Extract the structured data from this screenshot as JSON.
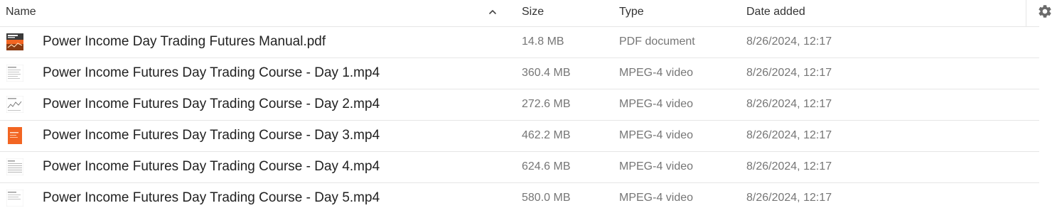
{
  "columns": {
    "name": "Name",
    "size": "Size",
    "type": "Type",
    "date_added": "Date added"
  },
  "sort": {
    "column": "name",
    "direction": "ascending",
    "icon": "chevron-up-icon"
  },
  "settings_icon": "gear-icon",
  "files": [
    {
      "name": "Power Income Day Trading Futures Manual.pdf",
      "size": "14.8 MB",
      "type": "PDF document",
      "date_added": "8/26/2024, 12:17",
      "thumbnail": "pdf-cover-thumbnail"
    },
    {
      "name": "Power Income Futures Day Trading Course - Day 1.mp4",
      "size": "360.4 MB",
      "type": "MPEG-4 video",
      "date_added": "8/26/2024, 12:17",
      "thumbnail": "document-page-thumbnail"
    },
    {
      "name": "Power Income Futures Day Trading Course - Day 2.mp4",
      "size": "272.6 MB",
      "type": "MPEG-4 video",
      "date_added": "8/26/2024, 12:17",
      "thumbnail": "chart-page-thumbnail"
    },
    {
      "name": "Power Income Futures Day Trading Course - Day 3.mp4",
      "size": "462.2 MB",
      "type": "MPEG-4 video",
      "date_added": "8/26/2024, 12:17",
      "thumbnail": "orange-slide-thumbnail"
    },
    {
      "name": "Power Income Futures Day Trading Course - Day 4.mp4",
      "size": "624.6 MB",
      "type": "MPEG-4 video",
      "date_added": "8/26/2024, 12:17",
      "thumbnail": "document-page-thumbnail"
    },
    {
      "name": "Power Income Futures Day Trading Course - Day 5.mp4",
      "size": "580.0 MB",
      "type": "MPEG-4 video",
      "date_added": "8/26/2024, 12:17",
      "thumbnail": "document-page-thumbnail"
    }
  ],
  "colors": {
    "name_text": "#222222",
    "meta_text": "#767676",
    "divider": "#e6e6e6",
    "accent_orange": "#f26522"
  }
}
